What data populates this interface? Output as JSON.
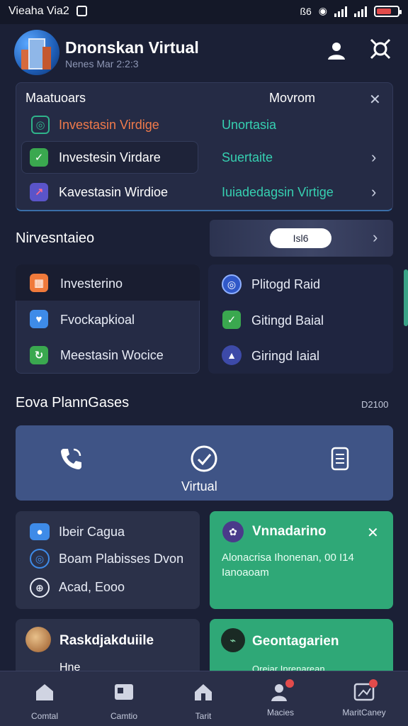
{
  "status_bar": {
    "carrier": "Vieaha Via2",
    "right_text": "ß6",
    "battery_color": "#e24b4b"
  },
  "header": {
    "title": "Dnonskan Virtual",
    "subtitle": "Nenes Mar 2:2:3"
  },
  "top_card": {
    "left_header": "Maatuoars",
    "right_header": "Movrom",
    "rows": [
      {
        "label": "Investasin Virdige",
        "value": "Unortasia",
        "label_color": "#f07a4b",
        "icon_color": "#1f8f6a",
        "has_chevron": false
      },
      {
        "label": "Investesin Virdare",
        "value": "Suertaite",
        "label_color": "#ffffff",
        "icon_color": "#3aa84f",
        "has_chevron": true
      },
      {
        "label": "Kavestasin Wirdioe",
        "value": "Iuiadedagsin Virtige",
        "label_color": "#ffffff",
        "icon_color": "#5a54c9",
        "has_chevron": true
      }
    ]
  },
  "section_investments": {
    "title": "Nirvesntaieo",
    "filter_pill": "Isl6",
    "left_items": [
      {
        "label": "Investerino",
        "icon": "grid-icon",
        "icon_color": "#f07a3b"
      },
      {
        "label": "Fvockapkioal",
        "icon": "heart-icon",
        "icon_color": "#3e8be8"
      },
      {
        "label": "Meestasin Wocice",
        "icon": "refresh-icon",
        "icon_color": "#3aa84f"
      }
    ],
    "right_items": [
      {
        "label": "Plitogd Raid",
        "icon": "globe-icon",
        "icon_color": "#3058c8"
      },
      {
        "label": "Gitingd Baial",
        "icon": "check-icon",
        "icon_color": "#3aa84f"
      },
      {
        "label": "Giringd Iaial",
        "icon": "mountain-icon",
        "icon_color": "#3d4aa8"
      }
    ]
  },
  "section_plans": {
    "title": "Eova PlannGases",
    "date": "D2100",
    "center_label": "Virtual"
  },
  "info_card": {
    "items": [
      {
        "label": "Ibeir Cagua",
        "icon": "message-icon"
      },
      {
        "label": "Boam Plabisses Dvon",
        "icon": "target-icon"
      },
      {
        "label": "Acad, Eooo",
        "icon": "globe-icon"
      }
    ]
  },
  "green_card": {
    "title": "Vnnadarino",
    "text_line1": "Alonacrisa Ihonenan, 00 I14",
    "text_line2": "Ianoaoam"
  },
  "bottom_cards": {
    "left_title": "Raskdjakduiile",
    "left_sub": "Hne",
    "right_title": "Geontagarien",
    "right_sub": "Oreiar Inrenarean"
  },
  "bottom_nav": [
    {
      "label": "Comtal",
      "icon": "home-icon"
    },
    {
      "label": "Camtio",
      "icon": "gallery-icon"
    },
    {
      "label": "Tarit",
      "icon": "house-icon"
    },
    {
      "label": "Macies",
      "icon": "people-icon"
    },
    {
      "label": "MaritCaney",
      "icon": "card-icon"
    }
  ]
}
